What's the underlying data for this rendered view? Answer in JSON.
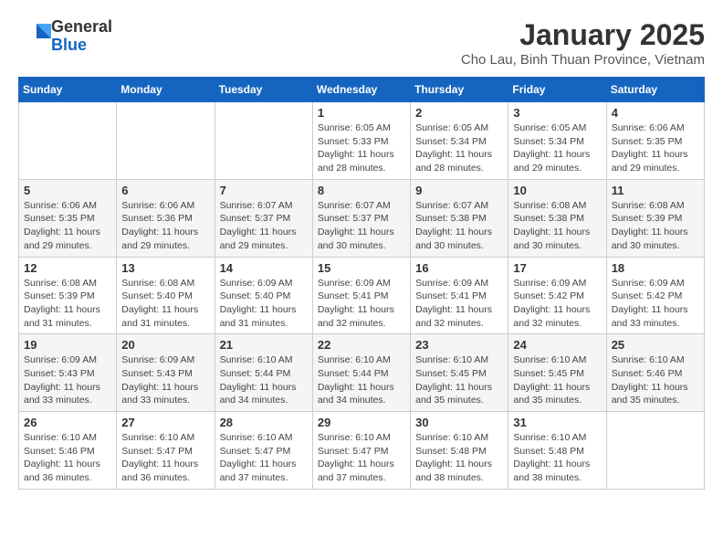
{
  "header": {
    "logo": {
      "general": "General",
      "blue": "Blue"
    },
    "title": "January 2025",
    "subtitle": "Cho Lau, Binh Thuan Province, Vietnam"
  },
  "calendar": {
    "weekdays": [
      "Sunday",
      "Monday",
      "Tuesday",
      "Wednesday",
      "Thursday",
      "Friday",
      "Saturday"
    ],
    "weeks": [
      [
        {
          "day": "",
          "info": ""
        },
        {
          "day": "",
          "info": ""
        },
        {
          "day": "",
          "info": ""
        },
        {
          "day": "1",
          "info": "Sunrise: 6:05 AM\nSunset: 5:33 PM\nDaylight: 11 hours and 28 minutes."
        },
        {
          "day": "2",
          "info": "Sunrise: 6:05 AM\nSunset: 5:34 PM\nDaylight: 11 hours and 28 minutes."
        },
        {
          "day": "3",
          "info": "Sunrise: 6:05 AM\nSunset: 5:34 PM\nDaylight: 11 hours and 29 minutes."
        },
        {
          "day": "4",
          "info": "Sunrise: 6:06 AM\nSunset: 5:35 PM\nDaylight: 11 hours and 29 minutes."
        }
      ],
      [
        {
          "day": "5",
          "info": "Sunrise: 6:06 AM\nSunset: 5:35 PM\nDaylight: 11 hours and 29 minutes."
        },
        {
          "day": "6",
          "info": "Sunrise: 6:06 AM\nSunset: 5:36 PM\nDaylight: 11 hours and 29 minutes."
        },
        {
          "day": "7",
          "info": "Sunrise: 6:07 AM\nSunset: 5:37 PM\nDaylight: 11 hours and 29 minutes."
        },
        {
          "day": "8",
          "info": "Sunrise: 6:07 AM\nSunset: 5:37 PM\nDaylight: 11 hours and 30 minutes."
        },
        {
          "day": "9",
          "info": "Sunrise: 6:07 AM\nSunset: 5:38 PM\nDaylight: 11 hours and 30 minutes."
        },
        {
          "day": "10",
          "info": "Sunrise: 6:08 AM\nSunset: 5:38 PM\nDaylight: 11 hours and 30 minutes."
        },
        {
          "day": "11",
          "info": "Sunrise: 6:08 AM\nSunset: 5:39 PM\nDaylight: 11 hours and 30 minutes."
        }
      ],
      [
        {
          "day": "12",
          "info": "Sunrise: 6:08 AM\nSunset: 5:39 PM\nDaylight: 11 hours and 31 minutes."
        },
        {
          "day": "13",
          "info": "Sunrise: 6:08 AM\nSunset: 5:40 PM\nDaylight: 11 hours and 31 minutes."
        },
        {
          "day": "14",
          "info": "Sunrise: 6:09 AM\nSunset: 5:40 PM\nDaylight: 11 hours and 31 minutes."
        },
        {
          "day": "15",
          "info": "Sunrise: 6:09 AM\nSunset: 5:41 PM\nDaylight: 11 hours and 32 minutes."
        },
        {
          "day": "16",
          "info": "Sunrise: 6:09 AM\nSunset: 5:41 PM\nDaylight: 11 hours and 32 minutes."
        },
        {
          "day": "17",
          "info": "Sunrise: 6:09 AM\nSunset: 5:42 PM\nDaylight: 11 hours and 32 minutes."
        },
        {
          "day": "18",
          "info": "Sunrise: 6:09 AM\nSunset: 5:42 PM\nDaylight: 11 hours and 33 minutes."
        }
      ],
      [
        {
          "day": "19",
          "info": "Sunrise: 6:09 AM\nSunset: 5:43 PM\nDaylight: 11 hours and 33 minutes."
        },
        {
          "day": "20",
          "info": "Sunrise: 6:09 AM\nSunset: 5:43 PM\nDaylight: 11 hours and 33 minutes."
        },
        {
          "day": "21",
          "info": "Sunrise: 6:10 AM\nSunset: 5:44 PM\nDaylight: 11 hours and 34 minutes."
        },
        {
          "day": "22",
          "info": "Sunrise: 6:10 AM\nSunset: 5:44 PM\nDaylight: 11 hours and 34 minutes."
        },
        {
          "day": "23",
          "info": "Sunrise: 6:10 AM\nSunset: 5:45 PM\nDaylight: 11 hours and 35 minutes."
        },
        {
          "day": "24",
          "info": "Sunrise: 6:10 AM\nSunset: 5:45 PM\nDaylight: 11 hours and 35 minutes."
        },
        {
          "day": "25",
          "info": "Sunrise: 6:10 AM\nSunset: 5:46 PM\nDaylight: 11 hours and 35 minutes."
        }
      ],
      [
        {
          "day": "26",
          "info": "Sunrise: 6:10 AM\nSunset: 5:46 PM\nDaylight: 11 hours and 36 minutes."
        },
        {
          "day": "27",
          "info": "Sunrise: 6:10 AM\nSunset: 5:47 PM\nDaylight: 11 hours and 36 minutes."
        },
        {
          "day": "28",
          "info": "Sunrise: 6:10 AM\nSunset: 5:47 PM\nDaylight: 11 hours and 37 minutes."
        },
        {
          "day": "29",
          "info": "Sunrise: 6:10 AM\nSunset: 5:47 PM\nDaylight: 11 hours and 37 minutes."
        },
        {
          "day": "30",
          "info": "Sunrise: 6:10 AM\nSunset: 5:48 PM\nDaylight: 11 hours and 38 minutes."
        },
        {
          "day": "31",
          "info": "Sunrise: 6:10 AM\nSunset: 5:48 PM\nDaylight: 11 hours and 38 minutes."
        },
        {
          "day": "",
          "info": ""
        }
      ]
    ]
  }
}
